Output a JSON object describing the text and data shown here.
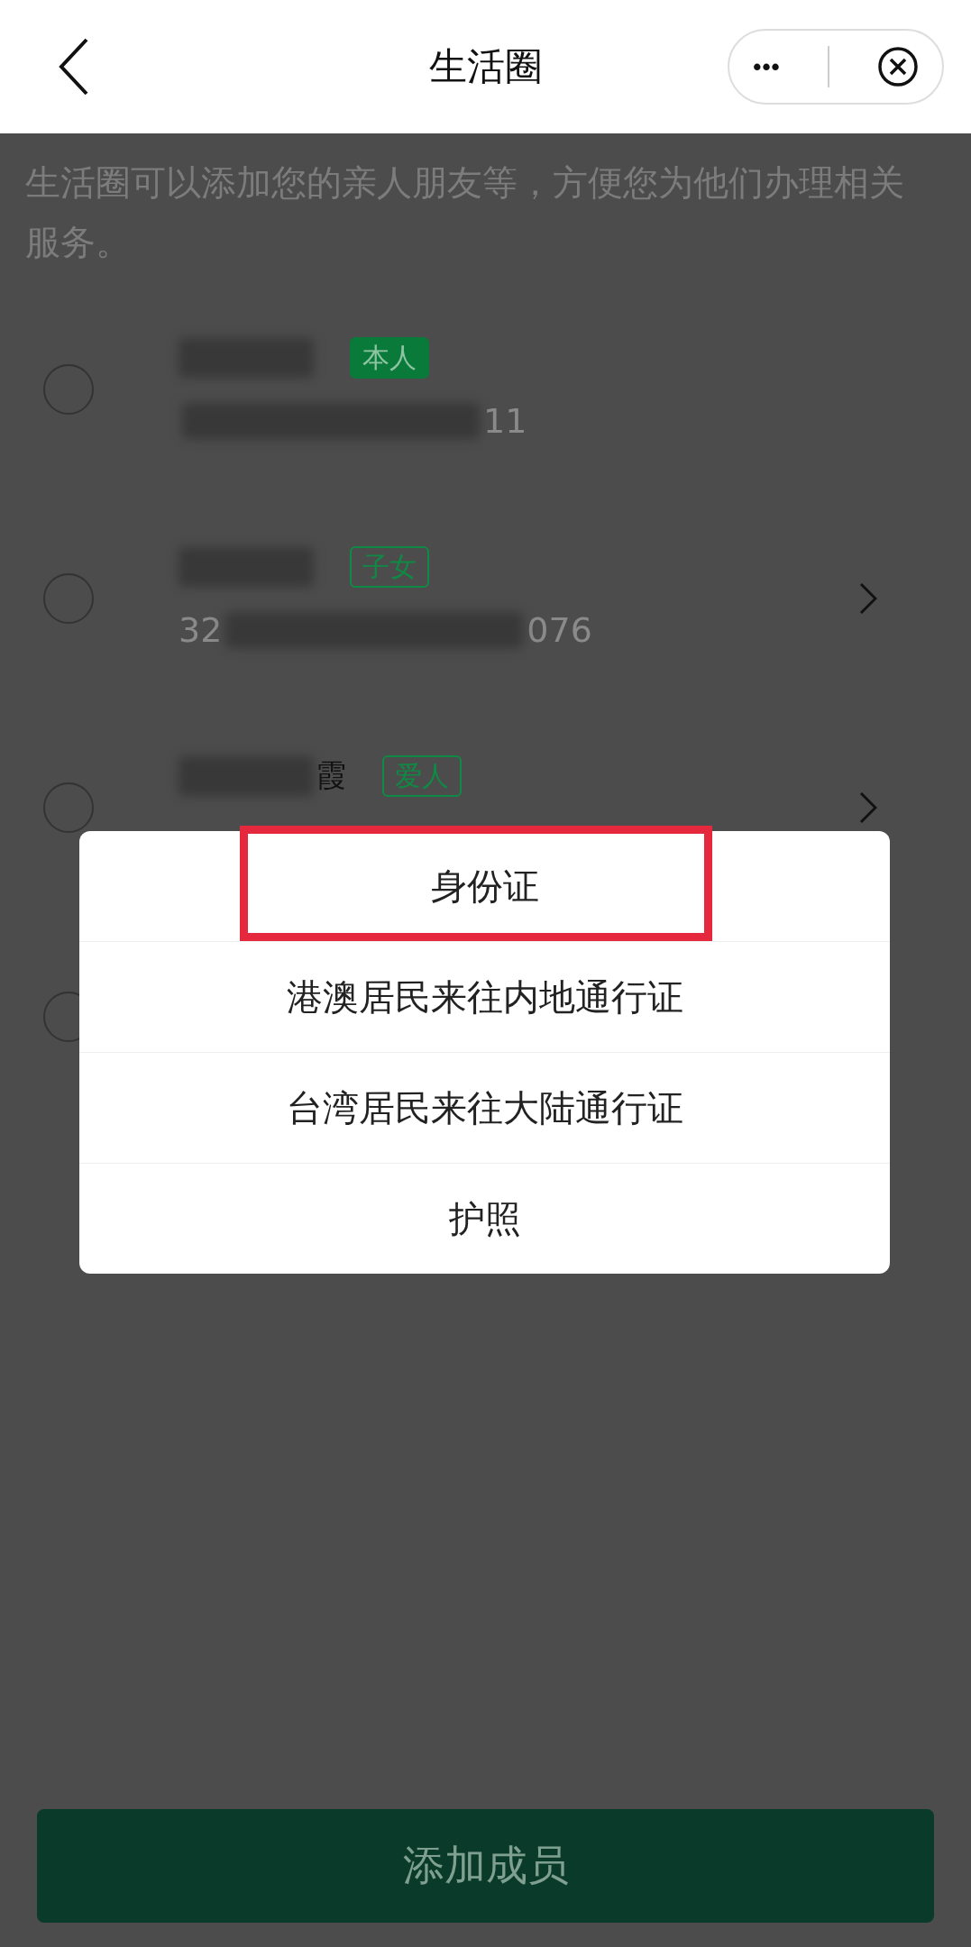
{
  "header": {
    "title": "生活圈",
    "more_glyph": "•••"
  },
  "description": "生活圈可以添加您的亲人朋友等，方便您为他们办理相关服务。",
  "members": [
    {
      "tag": "本人",
      "tag_filled": true,
      "id_tail": "11",
      "chevron": false,
      "selected": false
    },
    {
      "tag": "子女",
      "tag_filled": false,
      "id_head": "32",
      "id_tail": "076",
      "chevron": true,
      "selected": false
    },
    {
      "name_tail": "霞",
      "tag": "爱人",
      "tag_filled": false,
      "chevron": true,
      "selected": false
    },
    {
      "chevron": false,
      "selected": false
    }
  ],
  "dialog": {
    "options": [
      {
        "label": "身份证",
        "highlighted": true
      },
      {
        "label": "港澳居民来往内地通行证",
        "highlighted": false
      },
      {
        "label": "台湾居民来往大陆通行证",
        "highlighted": false
      },
      {
        "label": "护照",
        "highlighted": false
      }
    ]
  },
  "add_button": "添加成员"
}
